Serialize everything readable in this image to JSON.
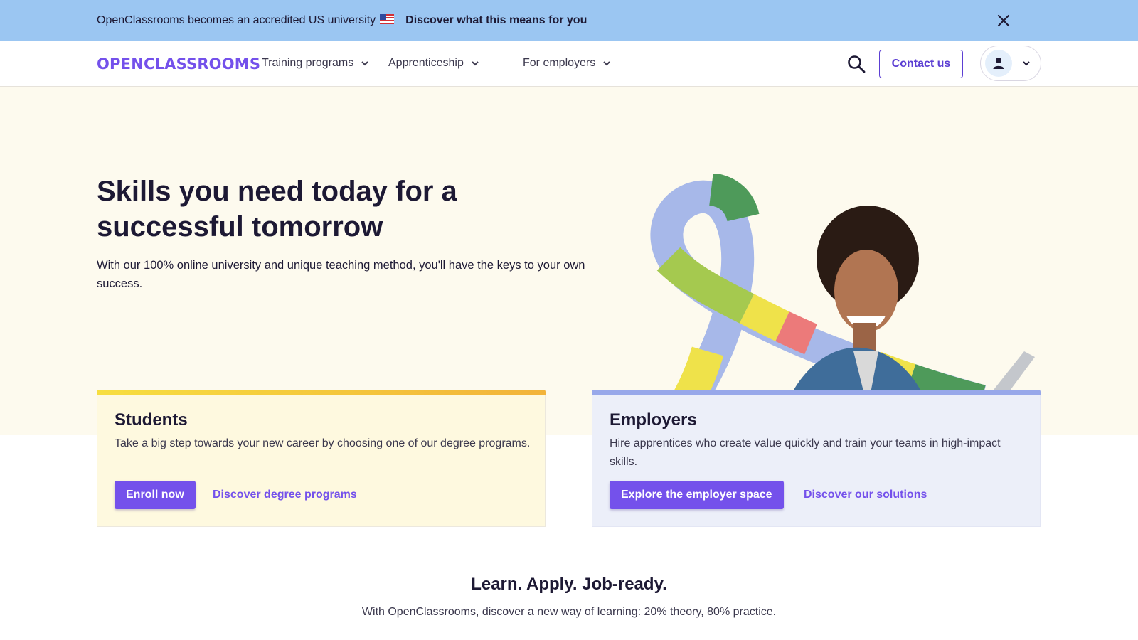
{
  "announcement": {
    "message": "OpenClassrooms becomes an accredited US university",
    "flag": "🇺🇸",
    "link": "Discover what this means for you",
    "close_icon": "close-icon"
  },
  "nav": {
    "logo": "OPENCLASSROOMS",
    "items": [
      {
        "label": "Training programs"
      },
      {
        "label": "Apprenticeship"
      },
      {
        "label": "For employers"
      }
    ],
    "search_icon": "search-icon",
    "contact_label": "Contact us",
    "account_icon": "user-icon"
  },
  "hero": {
    "title": "Skills you need today for a successful tomorrow",
    "subtitle": "With our 100% online university and unique teaching method, you'll have the keys to your own success."
  },
  "cards": {
    "students": {
      "title": "Students",
      "text": "Take a big step towards your new career by choosing one of our degree programs.",
      "primary": "Enroll now",
      "secondary": "Discover degree programs"
    },
    "employers": {
      "title": "Employers",
      "text": "Hire apprentices who create value quickly and train your teams in high-impact skills.",
      "primary": "Explore the employer space",
      "secondary": "Discover our solutions"
    }
  },
  "learn": {
    "title": "Learn. Apply. Job-ready.",
    "subtitle": "With OpenClassrooms, discover a new way of learning: 20% theory, 80% practice."
  },
  "colors": {
    "brand": "#7451eb",
    "announcement_bg": "#9bc6f2",
    "hero_bg": "#fdfaee",
    "students_card_bg": "#fef9df",
    "employers_card_bg": "#eceff9"
  }
}
